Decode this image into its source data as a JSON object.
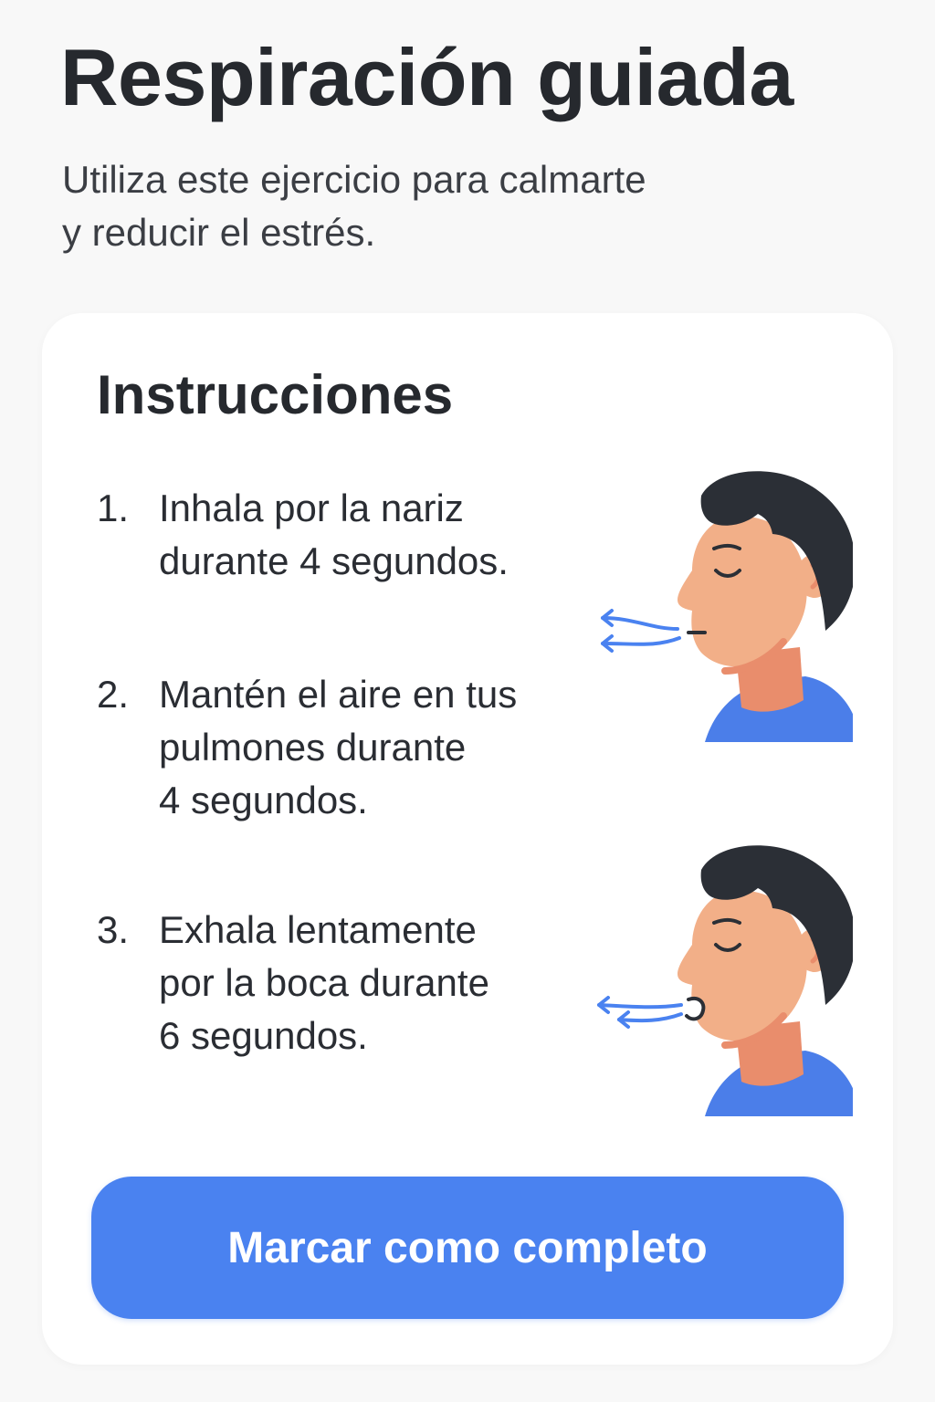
{
  "header": {
    "title": "Respiración guiada",
    "subtitle_lines": [
      "Utiliza este ejercicio para calmarte",
      "y reducir el estrés."
    ]
  },
  "card": {
    "title": "Instrucciones",
    "steps": [
      {
        "number": "1.",
        "lines": [
          "Inhala por la nariz",
          "durante 4 segundos."
        ]
      },
      {
        "number": "2.",
        "lines": [
          "Mantén el aire en tus",
          "pulmones durante",
          "4 segundos."
        ]
      },
      {
        "number": "3.",
        "lines": [
          "Exhala lentamente",
          "por la boca durante",
          "6 segundos."
        ]
      }
    ],
    "illustrations": [
      {
        "icon": "person-inhaling-icon",
        "mouth": "closed",
        "airflow": "inhale"
      },
      {
        "icon": "person-exhaling-icon",
        "mouth": "open",
        "airflow": "exhale"
      }
    ],
    "button_label": "Marcar como completo"
  },
  "colors": {
    "background": "#f8f8f8",
    "card": "#ffffff",
    "accent": "#4a82f0",
    "hair": "#2b2f36",
    "skin": "#f2af88",
    "skin_shadow": "#e98d6c",
    "shirt": "#4b7ee9",
    "airflow": "#4a82f0"
  }
}
